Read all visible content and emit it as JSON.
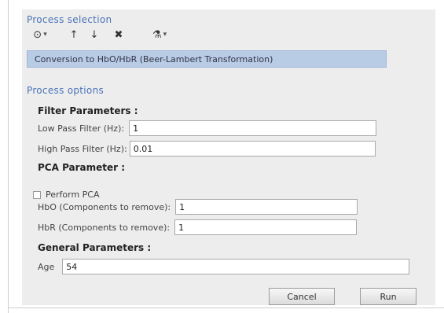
{
  "process_selection": {
    "title": "Process selection",
    "toolbar": [
      {
        "icon": "circle-icon",
        "glyph": "⊙",
        "caret": "▾"
      },
      {
        "icon": "arrow-up-icon",
        "glyph": "↑"
      },
      {
        "icon": "arrow-down-icon",
        "glyph": "↓"
      },
      {
        "icon": "delete-icon",
        "glyph": "✖"
      },
      {
        "icon": "tools-icon",
        "glyph": "⚗",
        "caret": "▾"
      }
    ],
    "selected_process": "Conversion to HbO/HbR (Beer-Lambert Transformation)"
  },
  "process_options": {
    "title": "Process options",
    "filter": {
      "title": "Filter Parameters :",
      "low_pass_label": "Low Pass Filter (Hz):",
      "low_pass_value": "1",
      "high_pass_label": "High Pass Filter (Hz):",
      "high_pass_value": "0.01"
    },
    "pca": {
      "title": "PCA Parameter :",
      "perform_label": "Perform PCA",
      "perform_checked": false,
      "hbo_label": "HbO (Components to remove):",
      "hbo_value": "1",
      "hbr_label": "HbR (Components to remove):",
      "hbr_value": "1"
    },
    "general": {
      "title": "General Parameters :",
      "age_label": "Age",
      "age_value": "54"
    }
  },
  "buttons": {
    "cancel": "Cancel",
    "run": "Run"
  },
  "colors": {
    "section_title": "#4a73b8",
    "selected_bar": "#b8cce6",
    "panel_bg": "#ededed"
  }
}
